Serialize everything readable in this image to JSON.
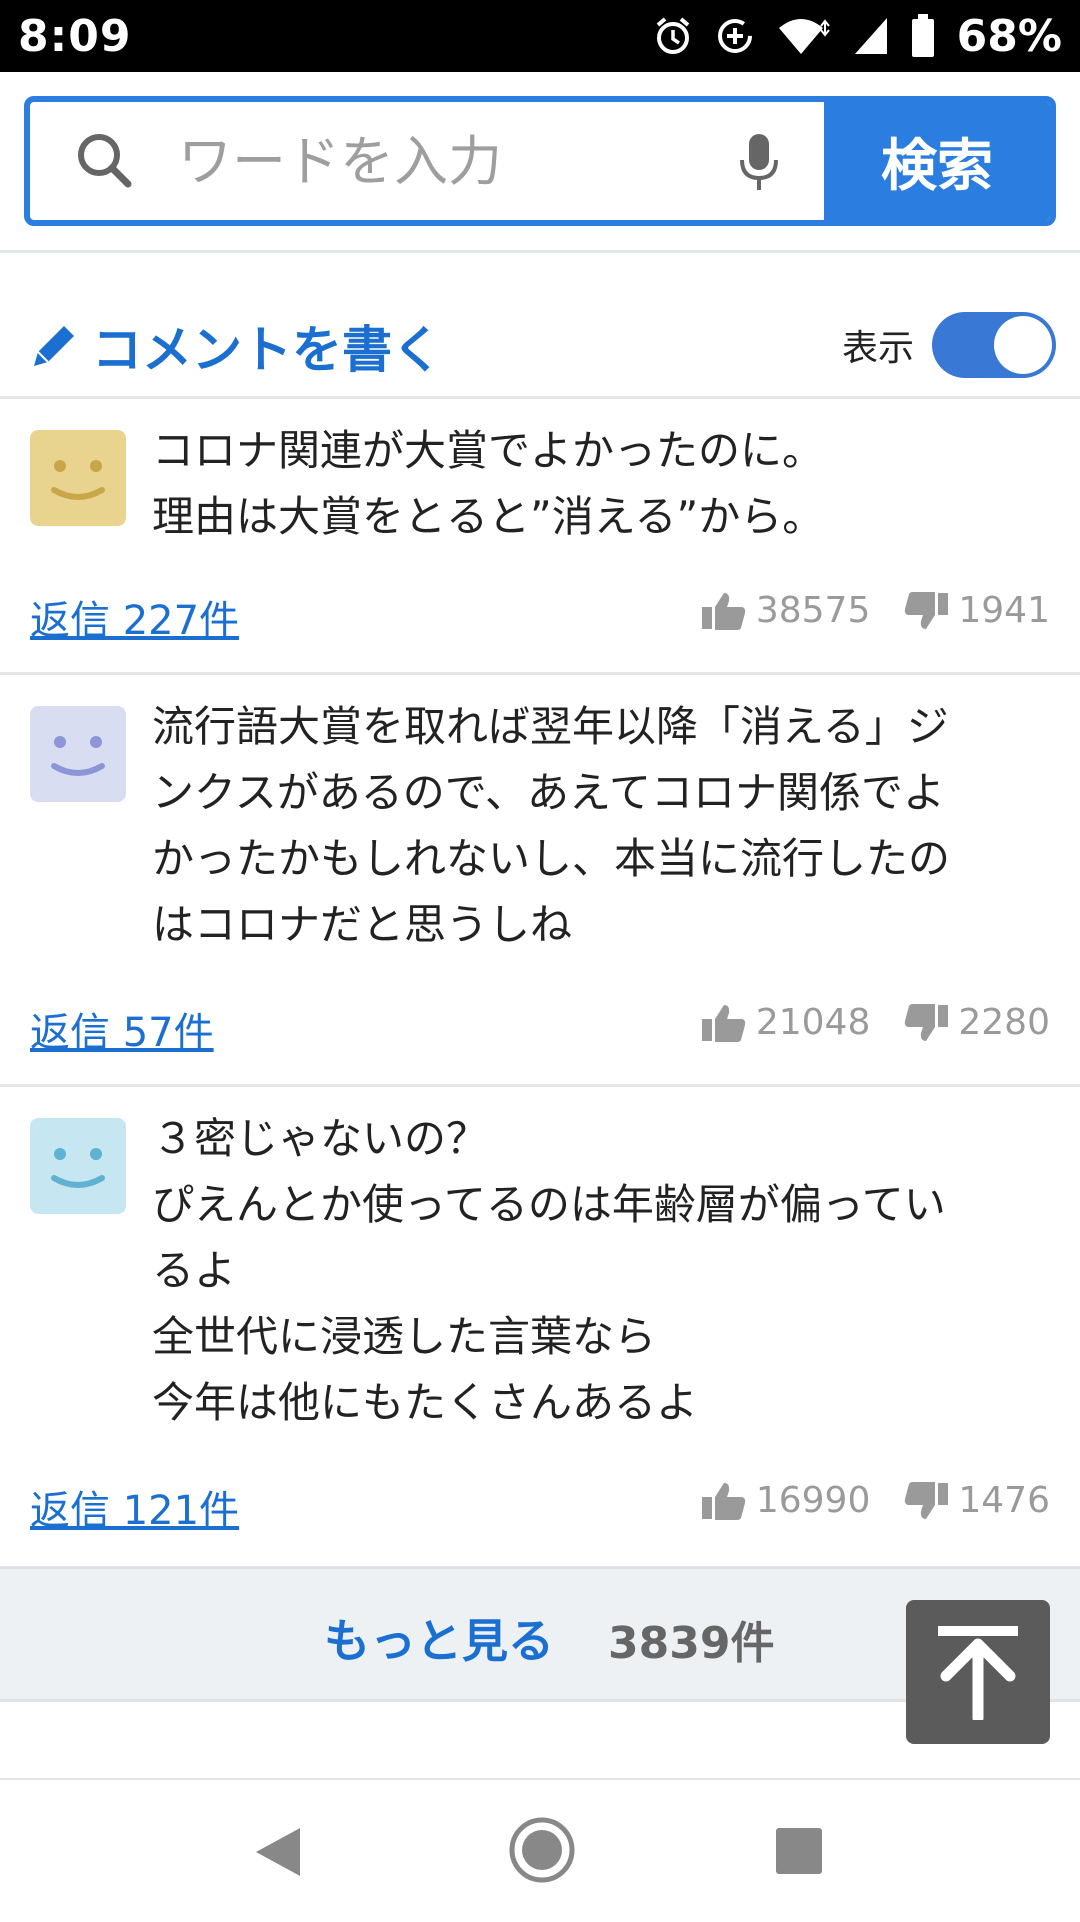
{
  "status_bar": {
    "time": "8:09",
    "battery": "68%",
    "icons": [
      "alarm-icon",
      "data-saver-icon",
      "wifi-icon",
      "signal-icon",
      "battery-icon"
    ]
  },
  "search": {
    "placeholder": "ワードを入力",
    "button_label": "検索"
  },
  "comment_header": {
    "write_label": "コメントを書く",
    "toggle_label": "表示",
    "toggle_on": true
  },
  "comments": [
    {
      "avatar_color": "#e8d48e",
      "face_color": "#c9a64a",
      "text": "コロナ関連が大賞でよかったのに。\n理由は大賞をとると”消える”から。",
      "reply": "返信 227件",
      "likes": "38575",
      "dislikes": "1941"
    },
    {
      "avatar_color": "#d9ddf2",
      "face_color": "#8c95d6",
      "text": "流行語大賞を取れば翌年以降「消える」ジ\nンクスがあるので、あえてコロナ関係でよ\nかったかもしれないし、本当に流行したの\nはコロナだと思うしね",
      "reply": "返信 57件",
      "likes": "21048",
      "dislikes": "2280"
    },
    {
      "avatar_color": "#c6e6f1",
      "face_color": "#5fb2d1",
      "text": "３密じゃないの？\nぴえんとか使ってるのは年齢層が偏ってい\nるよ\n全世代に浸透した言葉なら\n今年は他にもたくさんあるよ",
      "reply": "返信 121件",
      "likes": "16990",
      "dislikes": "1476"
    }
  ],
  "more": {
    "label": "もっと見る",
    "count": "3839件"
  },
  "colors": {
    "accent": "#2b7de0",
    "link": "#1b6fd1",
    "muted": "#9a9a9a"
  }
}
